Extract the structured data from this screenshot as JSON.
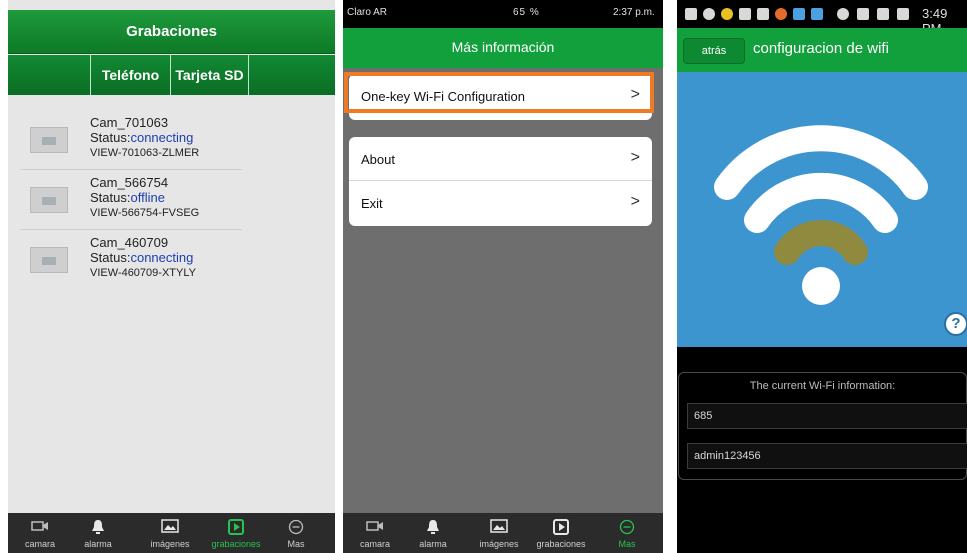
{
  "panel1": {
    "title": "Grabaciones",
    "tabs": [
      "Teléfono",
      "Tarjeta SD"
    ],
    "recordings": [
      {
        "name": "Cam_701063",
        "status_label": "Status:",
        "status": "connecting",
        "id": "VIEW-701063-ZLMER"
      },
      {
        "name": "Cam_566754",
        "status_label": "Status:",
        "status": "offline",
        "id": "VIEW-566754-FVSEG"
      },
      {
        "name": "Cam_460709",
        "status_label": "Status:",
        "status": "connecting",
        "id": "VIEW-460709-XTYLY"
      }
    ],
    "tabbar": [
      {
        "label": "camara",
        "icon": "camera-icon",
        "active": false
      },
      {
        "label": "alarma",
        "icon": "bell-icon",
        "active": false
      },
      {
        "label": "imágenes",
        "icon": "image-icon",
        "active": false
      },
      {
        "label": "grabaciones",
        "icon": "play-icon",
        "active": true
      },
      {
        "label": "Mas",
        "icon": "more-icon",
        "active": false
      }
    ]
  },
  "panel2": {
    "status": {
      "carrier": "Claro AR",
      "signal": "65 %",
      "time": "2:37 p.m."
    },
    "title": "Más información",
    "menu_group1": [
      {
        "label": "One-key Wi-Fi Configuration"
      }
    ],
    "menu_group2": [
      {
        "label": "About"
      },
      {
        "label": "Exit"
      }
    ],
    "chevron": ">",
    "tabbar": [
      {
        "label": "camara",
        "icon": "camera-icon",
        "active": false
      },
      {
        "label": "alarma",
        "icon": "bell-icon",
        "active": false
      },
      {
        "label": "imágenes",
        "icon": "image-icon",
        "active": false
      },
      {
        "label": "grabaciones",
        "icon": "play-icon",
        "active": false
      },
      {
        "label": "Mas",
        "icon": "more-icon",
        "active": true
      }
    ]
  },
  "panel3": {
    "status": {
      "time": "3:49 PM"
    },
    "back_label": "atrás",
    "title": "configuracion de wifi",
    "help": "?",
    "info_header": "The current Wi-Fi information:",
    "ssid_value": "685",
    "password_value": "admin123456"
  },
  "colors": {
    "green": "#12a03c",
    "active_tab": "#27c24f",
    "highlight": "#ef7a26",
    "wifi_bg": "#3d95cf",
    "wifi_signal": "#8f8a3e"
  }
}
